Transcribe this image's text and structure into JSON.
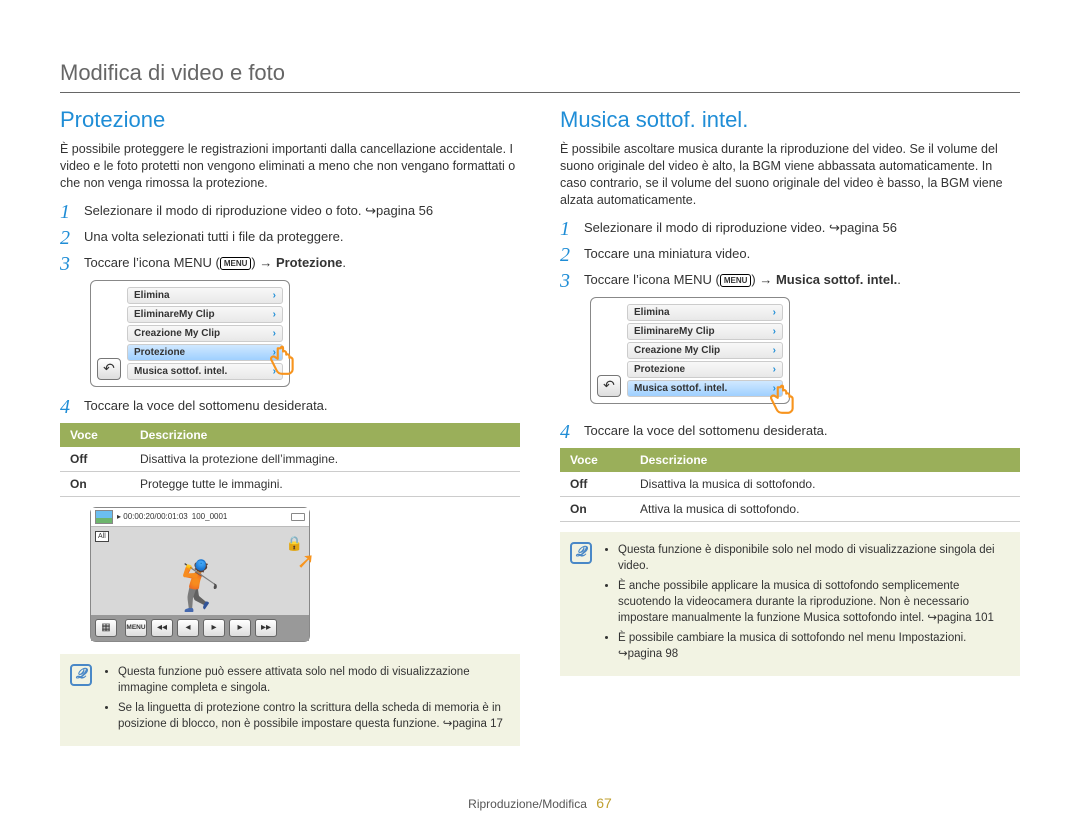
{
  "chapter_title": "Modifica di video e foto",
  "left": {
    "heading": "Protezione",
    "intro": "È possibile proteggere le registrazioni importanti dalla cancellazione accidentale. I video e le foto protetti non vengono eliminati a meno che non vengano formattati o che non venga rimossa la protezione.",
    "steps": {
      "s1": "Selezionare il modo di riproduzione video o foto. ↪pagina 56",
      "s2": "Una volta selezionati tutti i file da proteggere.",
      "s3_pre": "Toccare l’icona MENU (",
      "s3_badge": "MENU",
      "s3_post": ") → ",
      "s3_bold": "Protezione",
      "s3_end": ".",
      "s4": "Toccare la voce del sottomenu desiderata."
    },
    "menu": {
      "items": [
        "Elimina",
        "EliminareMy Clip",
        "Creazione My Clip",
        "Protezione",
        "Musica sottof. intel."
      ],
      "selected_index": 3
    },
    "table": {
      "h1": "Voce",
      "h2": "Descrizione",
      "rows": [
        {
          "k": "Off",
          "v": "Disattiva la protezione dell’immagine."
        },
        {
          "k": "On",
          "v": "Protegge tutte le immagini."
        }
      ]
    },
    "video": {
      "time": "00:00:20/00:01:03",
      "counter": "100_0001",
      "all": "All"
    },
    "note": [
      "Questa funzione può essere attivata solo nel modo di visualizzazione immagine completa e singola.",
      "Se la linguetta di protezione contro la scrittura della scheda di memoria è in posizione di blocco, non è possibile impostare questa funzione. ↪pagina 17"
    ]
  },
  "right": {
    "heading": "Musica sottof. intel.",
    "intro": "È possibile ascoltare musica durante la riproduzione del video. Se il volume del suono originale del video è alto, la BGM viene abbassata automaticamente. In caso contrario, se il volume del suono originale del video è basso, la BGM viene alzata automaticamente.",
    "steps": {
      "s1": "Selezionare il modo di riproduzione video. ↪pagina 56",
      "s2": "Toccare una miniatura video.",
      "s3_pre": "Toccare l’icona MENU (",
      "s3_badge": "MENU",
      "s3_post": ") → ",
      "s3_bold": "Musica sottof. intel.",
      "s3_end": ".",
      "s4": "Toccare la voce del sottomenu desiderata."
    },
    "menu": {
      "items": [
        "Elimina",
        "EliminareMy Clip",
        "Creazione My Clip",
        "Protezione",
        "Musica sottof. intel."
      ],
      "selected_index": 4
    },
    "table": {
      "h1": "Voce",
      "h2": "Descrizione",
      "rows": [
        {
          "k": "Off",
          "v": "Disattiva la musica di sottofondo."
        },
        {
          "k": "On",
          "v": "Attiva la musica di sottofondo."
        }
      ]
    },
    "note": [
      "Questa funzione è disponibile solo nel modo di visualizzazione singola dei video.",
      "È anche possibile applicare la musica di sottofondo semplicemente scuotendo la videocamera durante la riproduzione. Non è necessario impostare manualmente la funzione Musica sottofondo intel. ↪pagina 101",
      "È possibile cambiare la musica di sottofondo nel menu Impostazioni. ↪pagina 98"
    ]
  },
  "footer": {
    "section": "Riproduzione/Modifica",
    "page": "67"
  }
}
